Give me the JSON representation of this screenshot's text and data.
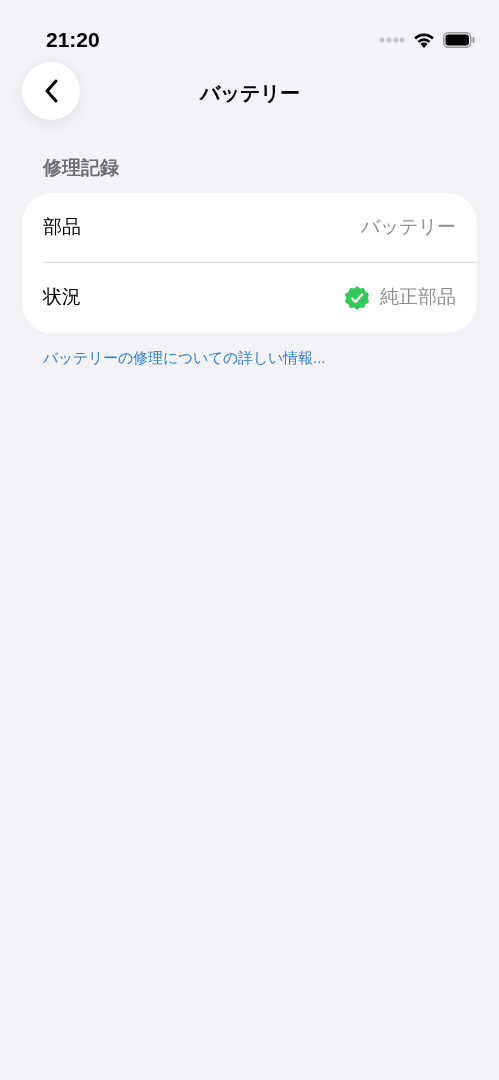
{
  "status_bar": {
    "time": "21:20"
  },
  "nav": {
    "title": "バッテリー"
  },
  "section": {
    "header": "修理記録",
    "rows": [
      {
        "label": "部品",
        "value": "バッテリー",
        "verified": false
      },
      {
        "label": "状況",
        "value": "純正部品",
        "verified": true
      }
    ],
    "link": "バッテリーの修理についての詳しい情報..."
  }
}
